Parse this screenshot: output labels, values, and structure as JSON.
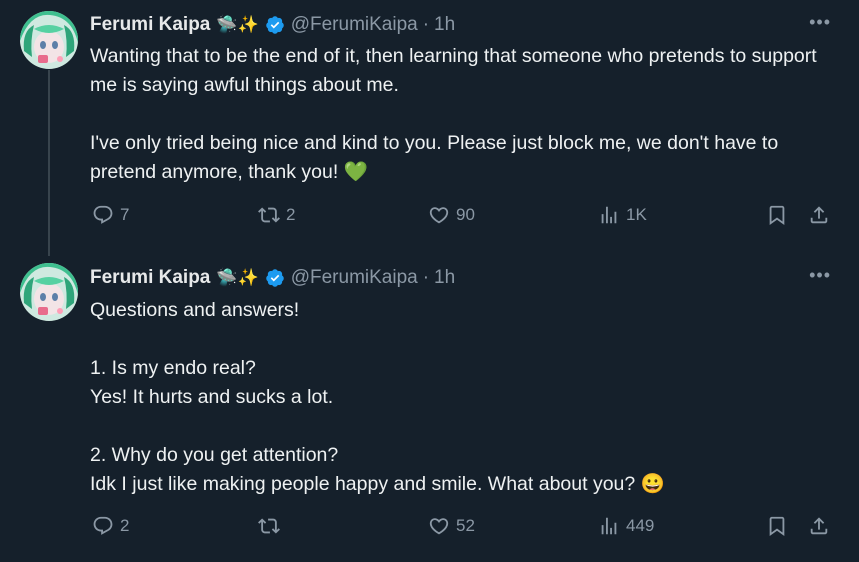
{
  "tweets": [
    {
      "author": "Ferumi Kaipa",
      "emojis": "🛸✨",
      "handle": "@FerumiKaipa",
      "separator": "·",
      "time": "1h",
      "more": "•••",
      "text": "Wanting that to be the end of it, then learning that someone who pretends to support me is saying awful things about me.\n\nI've only tried being nice and kind to you. Please just block me, we don't have to pretend anymore, thank you! 💚",
      "replies": "7",
      "reposts": "2",
      "likes": "90",
      "views": "1K"
    },
    {
      "author": "Ferumi Kaipa",
      "emojis": "🛸✨",
      "handle": "@FerumiKaipa",
      "separator": "·",
      "time": "1h",
      "more": "•••",
      "text": "Questions and answers!\n\n1. Is my endo real?\nYes! It hurts and sucks a lot.\n\n2. Why do you get attention?\nIdk I just like making people happy and smile. What about you? 😀",
      "replies": "2",
      "reposts": "",
      "likes": "52",
      "views": "449"
    }
  ],
  "colors": {
    "background": "#15202b",
    "text": "#e7e9ea",
    "muted": "#8b98a5",
    "verified": "#1d9bf0",
    "thread_line": "#38444d"
  },
  "icons": [
    "reply-icon",
    "retweet-icon",
    "like-icon",
    "views-icon",
    "bookmark-icon",
    "share-icon",
    "verified-badge-icon",
    "more-options-icon"
  ]
}
